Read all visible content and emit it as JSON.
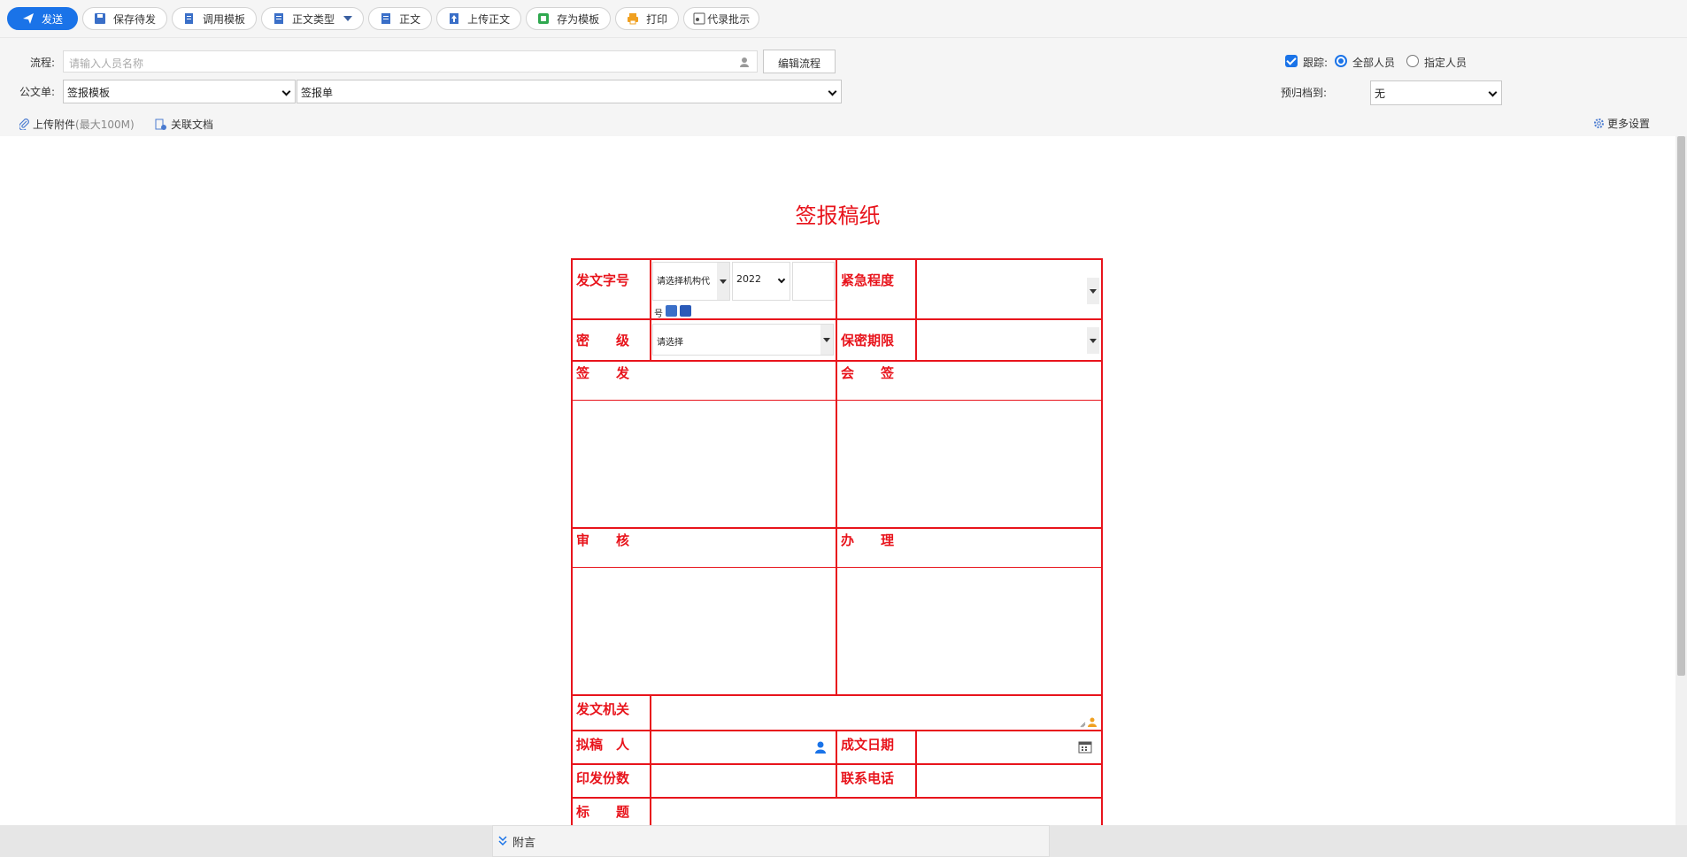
{
  "toolbar": {
    "send": "发送",
    "save_pending": "保存待发",
    "use_template": "调用模板",
    "body_type": "正文类型",
    "body": "正文",
    "upload_body": "上传正文",
    "save_as_template": "存为模板",
    "print": "打印",
    "proxy_comment": "代录批示"
  },
  "header": {
    "process_label": "流程:",
    "process_placeholder": "请输入人员名称",
    "edit_process": "编辑流程",
    "doc_form_label": "公文单:",
    "doc_form_template": "签报模板",
    "doc_form_type": "签报单",
    "track_label": "跟踪:",
    "track_checked": true,
    "radio_all": "全部人员",
    "radio_specified": "指定人员",
    "archive_label": "预归档到:",
    "archive_value": "无",
    "upload_attachment": "上传附件",
    "upload_limit": "(最大100M)",
    "related_docs": "关联文档",
    "more_settings": "更多设置"
  },
  "document": {
    "title": "签报稿纸",
    "fields": {
      "doc_number": "发文字号",
      "org_select": "请选择机构代",
      "year": "2022",
      "num_suffix": "号",
      "urgency": "紧急程度",
      "secret_level": "密　　级",
      "secret_select": "请选择",
      "secret_period": "保密期限",
      "sign_issue": "签　　发",
      "countersign": "会　　签",
      "review": "审　　核",
      "handle": "办　　理",
      "issuing_org": "发文机关",
      "drafter": "拟稿　人",
      "date": "成文日期",
      "copies": "印发份数",
      "phone": "联系电话",
      "subject": "标　　题"
    }
  },
  "footer": {
    "note": "附言"
  },
  "colors": {
    "accent": "#1a73e8",
    "form_red": "#e8141c"
  }
}
